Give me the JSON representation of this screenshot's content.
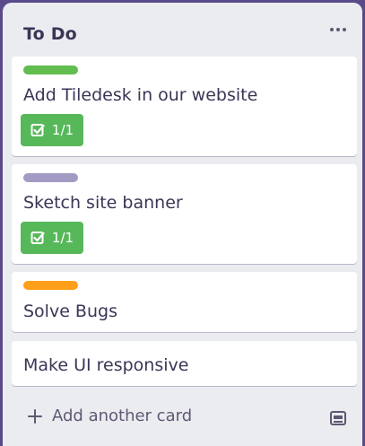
{
  "list": {
    "title": "To Do",
    "menu_icon": "more-horizontal-icon",
    "cards": [
      {
        "title": "Add Tiledesk in our website",
        "label_color": "#61bd4f",
        "checklist": "1/1"
      },
      {
        "title": "Sketch site banner",
        "label_color": "#a39bc4",
        "checklist": "1/1"
      },
      {
        "title": "Solve Bugs",
        "label_color": "#ff9f1a"
      },
      {
        "title": "Make UI responsive"
      }
    ],
    "add_card_label": "Add another card",
    "add_icon": "plus-icon",
    "template_icon": "card-template-icon"
  },
  "colors": {
    "badge_complete": "#57b85a",
    "list_background": "#ebecf0",
    "board_background": "#5b4a8a"
  }
}
